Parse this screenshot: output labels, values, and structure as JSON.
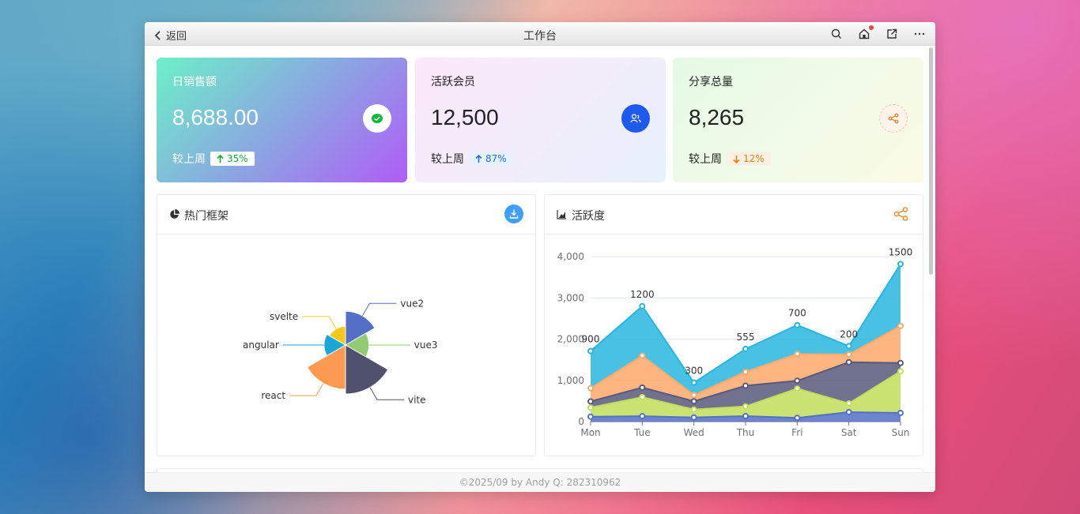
{
  "window": {
    "title": "工作台",
    "back_label": "返回"
  },
  "cards": [
    {
      "label": "日销售额",
      "value": "8,688.00",
      "compare_label": "较上周",
      "change": "35%",
      "direction": "up",
      "icon": "wechat-icon"
    },
    {
      "label": "活跃会员",
      "value": "12,500",
      "compare_label": "较上周",
      "change": "87%",
      "direction": "up",
      "icon": "user-group-icon"
    },
    {
      "label": "分享总量",
      "value": "8,265",
      "compare_label": "较上周",
      "change": "12%",
      "direction": "down",
      "icon": "share-icon"
    }
  ],
  "panels": {
    "pie": {
      "title": "热门框架",
      "action_icon": "download-icon"
    },
    "area": {
      "title": "活跃度",
      "action_icon": "share-icon"
    }
  },
  "footer": "©2025/09 by Andy Q: 282310962",
  "chart_data": [
    {
      "type": "pie",
      "variant": "rose",
      "slices": [
        {
          "name": "vue2",
          "value": 40,
          "color": "#5470c6"
        },
        {
          "name": "vue3",
          "value": 25,
          "color": "#91cc75"
        },
        {
          "name": "vite",
          "value": 62,
          "color": "#50516f"
        },
        {
          "name": "react",
          "value": 55,
          "color": "#fc9a52"
        },
        {
          "name": "angular",
          "value": 22,
          "color": "#1aa6d6"
        },
        {
          "name": "svelte",
          "value": 18,
          "color": "#f5c81b"
        }
      ]
    },
    {
      "type": "area",
      "stacked": true,
      "categories": [
        "Mon",
        "Tue",
        "Wed",
        "Thu",
        "Fri",
        "Sat",
        "Sun"
      ],
      "ylim": [
        0,
        4000
      ],
      "yticks": [
        "0",
        "1,000",
        "2,000",
        "3,000",
        "4,000"
      ],
      "series": [
        {
          "values": [
            120,
            132,
            101,
            134,
            90,
            230,
            210
          ],
          "color": "#5470c6"
        },
        {
          "values": [
            220,
            462,
            191,
            234,
            710,
            210,
            1010
          ],
          "color": "#c2de5a"
        },
        {
          "values": [
            150,
            232,
            201,
            504,
            190,
            1000,
            200
          ],
          "color": "#58597b"
        },
        {
          "values": [
            320,
            772,
            151,
            334,
            650,
            190,
            900
          ],
          "color": "#fea869"
        },
        {
          "values": [
            900,
            1200,
            300,
            555,
            700,
            200,
            1500
          ],
          "color": "#28b6e0"
        }
      ],
      "top_labels": [
        "900",
        "1200",
        "300",
        "555",
        "700",
        "200",
        "1500"
      ]
    }
  ]
}
